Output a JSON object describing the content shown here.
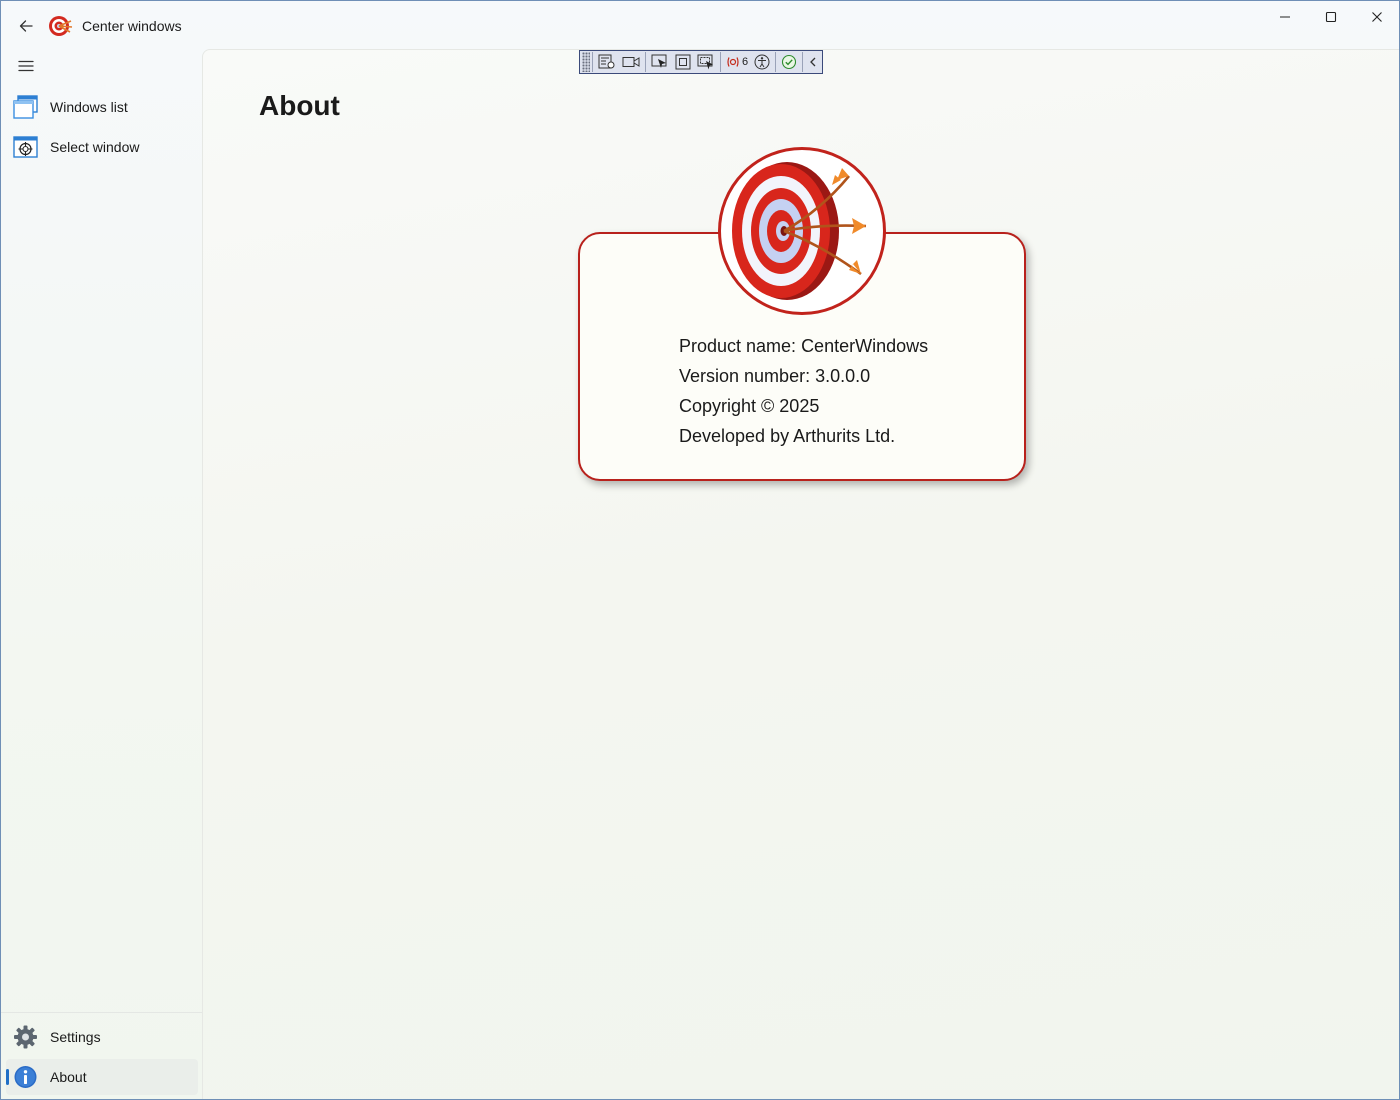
{
  "window": {
    "title": "Center windows"
  },
  "toolbar": {
    "binding_errors_count": "6"
  },
  "sidebar": {
    "items": [
      {
        "label": "Windows list",
        "icon": "windows-list-icon"
      },
      {
        "label": "Select window",
        "icon": "target-window-icon"
      }
    ],
    "footer_items": [
      {
        "label": "Settings",
        "icon": "gear-icon"
      },
      {
        "label": "About",
        "icon": "info-icon",
        "selected": true
      }
    ]
  },
  "page": {
    "title": "About"
  },
  "about": {
    "product_name": "Product name: CenterWindows",
    "version": "Version number: 3.0.0.0",
    "copyright": "Copyright © 2025",
    "developer": "Developed by Arthurits Ltd."
  },
  "colors": {
    "accent": "#1f6fc6",
    "card_border": "#b8211c",
    "card_background": "#fdfdf8"
  }
}
